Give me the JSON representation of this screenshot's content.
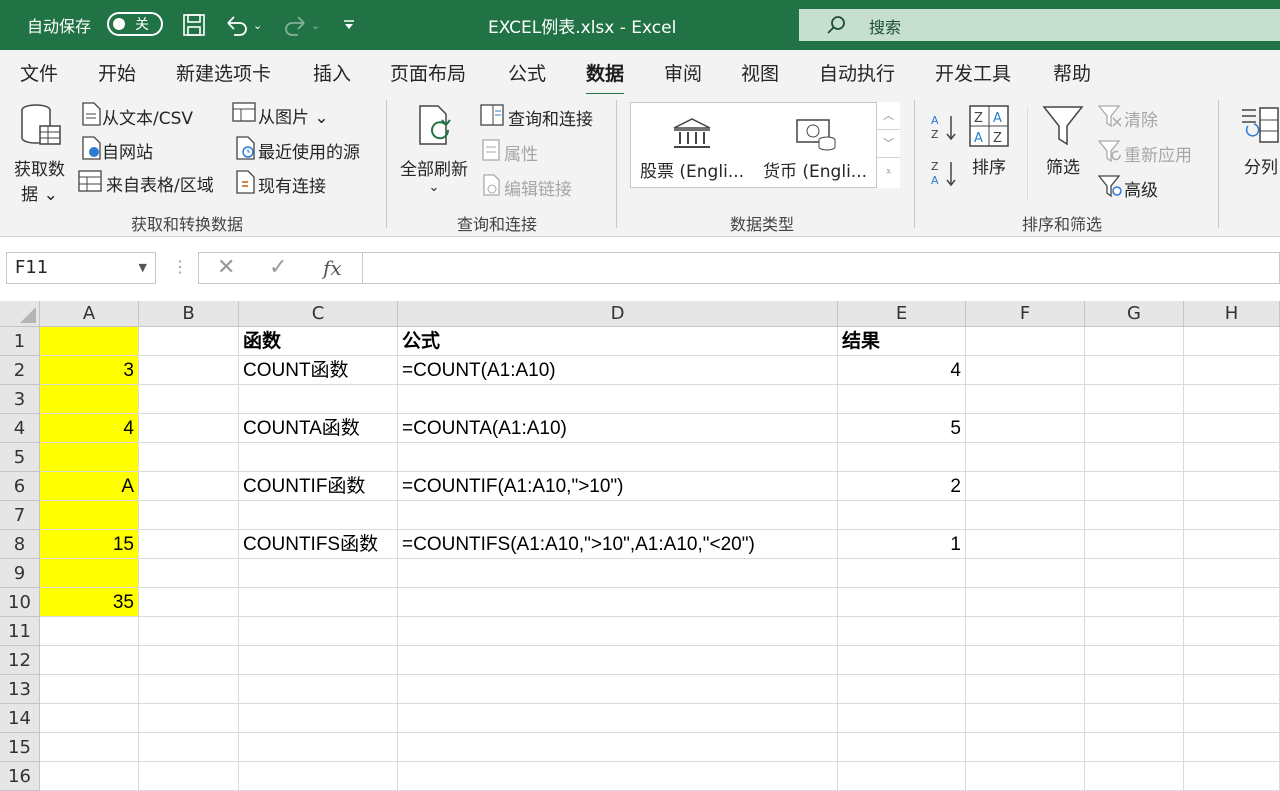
{
  "titlebar": {
    "autosave_label": "自动保存",
    "autosave_state": "关",
    "file_title": "EXCEL例表.xlsx  -  Excel",
    "search_placeholder": "搜索"
  },
  "tabs": [
    "文件",
    "开始",
    "新建选项卡",
    "插入",
    "页面布局",
    "公式",
    "数据",
    "审阅",
    "视图",
    "自动执行",
    "开发工具",
    "帮助"
  ],
  "active_tab": "数据",
  "ribbon": {
    "get_data_line1": "获取数",
    "get_data_line2": "据 ⌄",
    "from_text_csv": "从文本/CSV",
    "from_web": "自网站",
    "from_table": "来自表格/区域",
    "from_picture": "从图片 ⌄",
    "recent_sources": "最近使用的源",
    "existing_connections": "现有连接",
    "group_get_transform": "获取和转换数据",
    "refresh_all_line1": "全部刷新",
    "refresh_all_line2": "⌄",
    "queries_connections": "查询和连接",
    "properties": "属性",
    "edit_links": "编辑链接",
    "group_queries": "查询和连接",
    "stocks": "股票 (Engli...",
    "currencies": "货币 (Engli...",
    "group_data_types": "数据类型",
    "sort": "排序",
    "filter": "筛选",
    "clear": "清除",
    "reapply": "重新应用",
    "advanced": "高级",
    "group_sort_filter": "排序和筛选",
    "text_to_columns": "分列"
  },
  "formula_bar": {
    "name_box": "F11",
    "formula": ""
  },
  "columns": [
    "A",
    "B",
    "C",
    "D",
    "E",
    "F",
    "G",
    "H"
  ],
  "rows": [
    "1",
    "2",
    "3",
    "4",
    "5",
    "6",
    "7",
    "8",
    "9",
    "10",
    "11",
    "12",
    "13",
    "14",
    "15",
    "16"
  ],
  "cells": {
    "C1": "函数",
    "D1": "公式",
    "E1": "结果",
    "A2": "3",
    "C2": "COUNT函数",
    "D2": "=COUNT(A1:A10)",
    "E2": "4",
    "A4": "4",
    "C4": "COUNTA函数",
    "D4": "=COUNTA(A1:A10)",
    "E4": "5",
    "A6": "A",
    "C6": "COUNTIF函数",
    "D6": "=COUNTIF(A1:A10,\">10\")",
    "E6": "2",
    "A8": "15",
    "C8": "COUNTIFS函数",
    "D8": "=COUNTIFS(A1:A10,\">10\",A1:A10,\"<20\")",
    "E8": "1",
    "A10": "35"
  },
  "colors": {
    "title_bar": "#217346",
    "highlight": "#ffff00",
    "active_tab_underline": "#217346"
  }
}
